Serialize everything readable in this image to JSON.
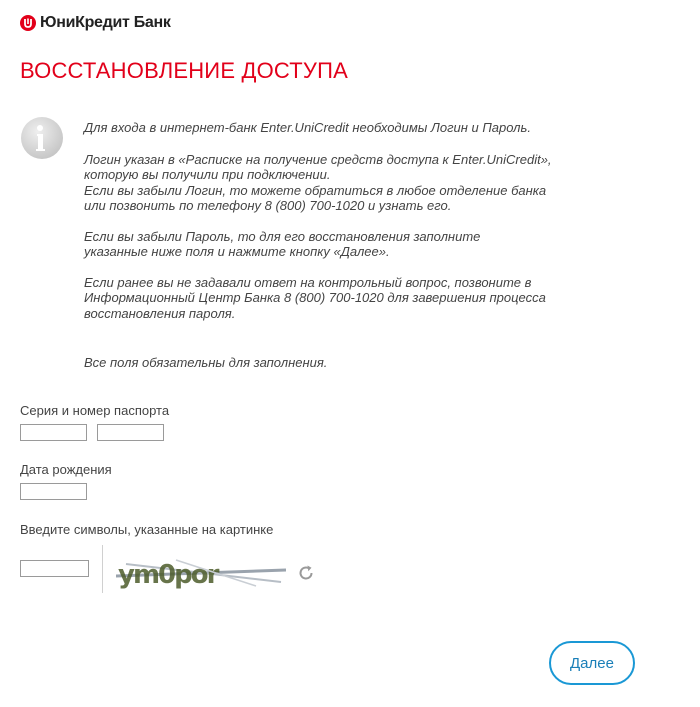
{
  "header": {
    "bank_name": "ЮниКредит Банк",
    "brand_color": "#e2001a",
    "logo_icon": "unicredit-logo-icon"
  },
  "page": {
    "title": "ВОССТАНОВЛЕНИЕ ДОСТУПА"
  },
  "info": {
    "icon": "info-icon",
    "paragraphs": [
      "Для входа в интернет-банк Enter.UniCredit необходимы Логин и Пароль.",
      "Логин указан в «Расписке на получение средств доступа к Enter.UniCredit»,\nкоторую вы получили при подключении.\nЕсли вы забыли Логин, то можете обратиться в любое отделение банка\nили позвонить по телефону 8 (800) 700-1020 и узнать его.",
      "Если вы забыли Пароль, то для его восстановления заполните\nуказанные ниже поля и нажмите кнопку «Далее».",
      "Если ранее вы не задавали ответ на контрольный вопрос, позвоните в\nИнформационный Центр Банка 8 (800) 700-1020 для завершения процесса\nвосстановления пароля.",
      "Все поля обязательны для заполнения."
    ]
  },
  "form": {
    "passport_label": "Серия и номер паспорта",
    "passport_series_value": "",
    "passport_number_value": "",
    "birthdate_label": "Дата рождения",
    "birthdate_value": "",
    "captcha_label": "Введите символы, указанные на картинке",
    "captcha_value": "",
    "captcha_text": "ym0por",
    "refresh_icon": "refresh-icon"
  },
  "actions": {
    "next_label": "Далее",
    "accent_color": "#1a98d5"
  }
}
